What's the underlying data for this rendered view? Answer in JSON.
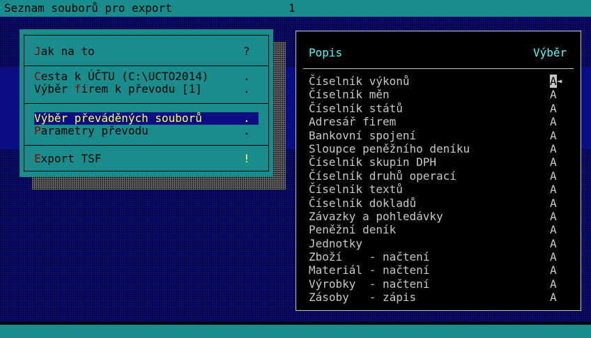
{
  "title_bar": {
    "title": "Seznam souborů pro export",
    "number": "1"
  },
  "menu": {
    "items": [
      {
        "hot": "J",
        "rest": "ak na to",
        "mark": "?"
      },
      {
        "hot": "C",
        "rest": "esta k ÚČTU (C:\\UCTO2014)",
        "mark": "."
      },
      {
        "pre": "Výběr ",
        "hot": "f",
        "rest": "irem k převodu [1]",
        "mark": "."
      },
      {
        "label": "Výběr převáděných souborů",
        "mark": "."
      },
      {
        "hot": "P",
        "rest": "arametry převodu",
        "mark": "."
      },
      {
        "hot": "E",
        "rest": "xport TSF",
        "mark": "!"
      }
    ]
  },
  "panel": {
    "header_description": "Popis",
    "header_selection": "Výběr",
    "rows": [
      {
        "name": "Číselník výkonů",
        "value": "A"
      },
      {
        "name": "Číselník měn",
        "value": "A"
      },
      {
        "name": "Číselník států",
        "value": "A"
      },
      {
        "name": "Adresář firem",
        "value": "A"
      },
      {
        "name": "Bankovní spojení",
        "value": "A"
      },
      {
        "name": "Sloupce peněžního deníku",
        "value": "A"
      },
      {
        "name": "Číselník skupin DPH",
        "value": "A"
      },
      {
        "name": "Číselník druhů operací",
        "value": "A"
      },
      {
        "name": "Číselník textů",
        "value": "A"
      },
      {
        "name": "Číselník dokladů",
        "value": "A"
      },
      {
        "name": "Závazky a pohledávky",
        "value": "A"
      },
      {
        "name": "Peněžní deník",
        "value": "A"
      },
      {
        "name": "Jednotky",
        "value": "A"
      },
      {
        "name": "Zboží    - načtení",
        "value": "A"
      },
      {
        "name": "Materiál - načtení",
        "value": "A"
      },
      {
        "name": "Výrobky  - načtení",
        "value": "A"
      },
      {
        "name": "Zásoby   - zápis",
        "value": "A"
      }
    ]
  }
}
